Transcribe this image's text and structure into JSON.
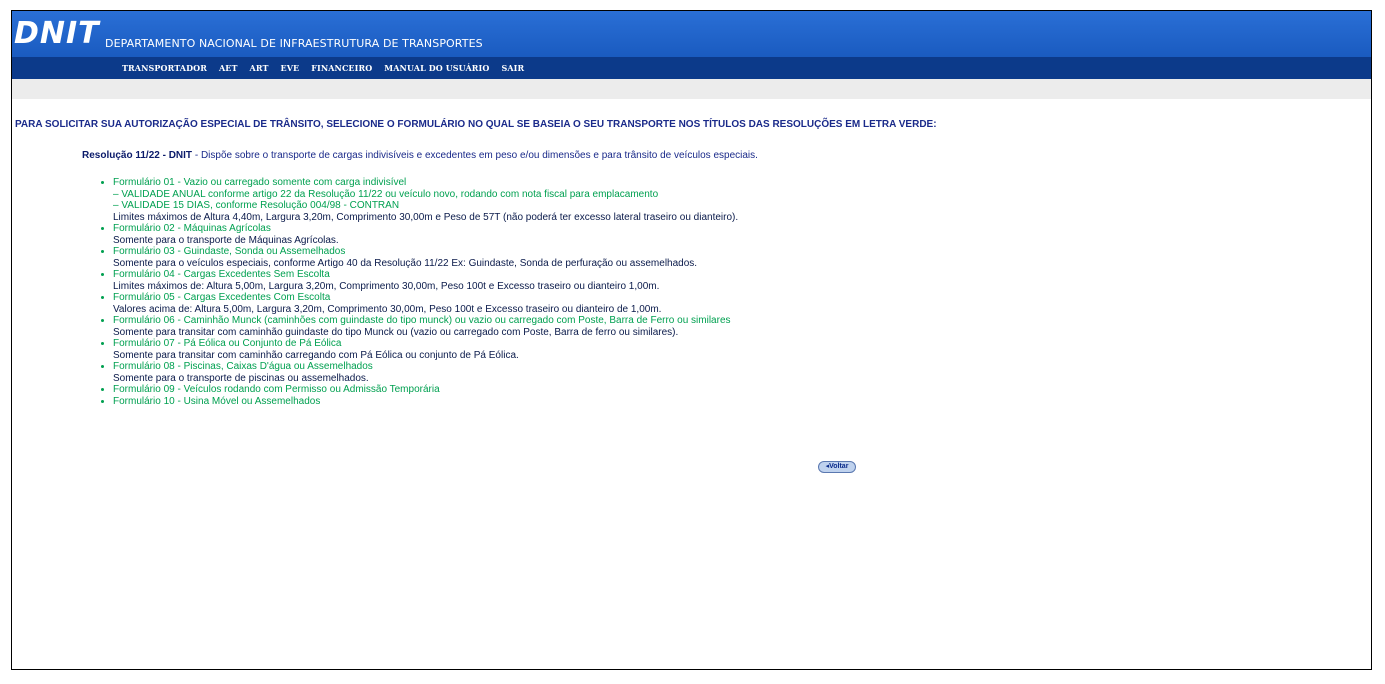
{
  "header": {
    "logo": "DNIT",
    "subtitle": "DEPARTAMENTO NACIONAL DE INFRAESTRUTURA DE TRANSPORTES"
  },
  "nav": [
    "TRANSPORTADOR",
    "AET",
    "ART",
    "EVE",
    "FINANCEIRO",
    "MANUAL DO USUÁRIO",
    "SAIR"
  ],
  "intro": "PARA SOLICITAR SUA AUTORIZAÇÃO ESPECIAL DE TRÂNSITO, SELECIONE O FORMULÁRIO NO QUAL SE BASEIA O SEU TRANSPORTE NOS TÍTULOS DAS RESOLUÇÕES EM LETRA VERDE:",
  "resolution": {
    "code": "Resolução 11/22 - DNIT",
    "separator": " - ",
    "description": "Dispõe sobre o transporte de cargas indivisíveis e excedentes em peso e/ou dimensões e para trânsito de veículos especiais."
  },
  "forms": [
    {
      "title": "Formulário 01 - Vazio ou carregado somente com carga indivisível",
      "green_notes": [
        "– VALIDADE ANUAL conforme artigo 22 da Resolução 11/22 ou veículo novo, rodando com nota fiscal para emplacamento",
        "– VALIDADE 15 DIAS, conforme Resolução 004/98 - CONTRAN"
      ],
      "desc": "Limites máximos de Altura 4,40m, Largura 3,20m, Comprimento 30,00m e Peso de 57T (não poderá ter excesso lateral traseiro ou dianteiro)."
    },
    {
      "title": "Formulário 02 - Máquinas Agrícolas",
      "desc": "Somente para o transporte de Máquinas Agrícolas."
    },
    {
      "title": "Formulário 03 - Guindaste, Sonda ou Assemelhados",
      "desc": "Somente para o veículos especiais, conforme Artigo 40 da Resolução 11/22 Ex: Guindaste, Sonda de perfuração ou assemelhados."
    },
    {
      "title": "Formulário 04 - Cargas Excedentes Sem Escolta",
      "desc": "Limites máximos de: Altura 5,00m, Largura 3,20m, Comprimento 30,00m, Peso 100t e Excesso traseiro ou dianteiro 1,00m."
    },
    {
      "title": "Formulário 05 - Cargas Excedentes Com Escolta",
      "desc": "Valores acima de: Altura 5,00m, Largura 3,20m, Comprimento 30,00m, Peso 100t e Excesso traseiro ou dianteiro de 1,00m."
    },
    {
      "title": "Formulário 06 - Caminhão Munck (caminhões com guindaste do tipo munck) ou vazio ou carregado com Poste, Barra de Ferro ou similares",
      "desc": "Somente para transitar com caminhão guindaste do tipo Munck ou (vazio ou carregado com Poste, Barra de ferro ou similares)."
    },
    {
      "title": "Formulário 07 - Pá Eólica ou Conjunto de Pá Eólica",
      "desc": "Somente para transitar com caminhão carregando com Pá Eólica ou conjunto de Pá Eólica."
    },
    {
      "title": "Formulário 08 - Piscinas, Caixas D'água ou Assemelhados",
      "desc": "Somente para o transporte de piscinas ou assemelhados."
    },
    {
      "title": "Formulário 09 - Veículos rodando com Permisso ou Admissão Temporária",
      "desc": ""
    },
    {
      "title": "Formulário 10 - Usina Móvel ou Assemelhados",
      "desc": ""
    }
  ],
  "voltar_label": "Voltar",
  "colors": {
    "header": "#1f63c9",
    "nav": "#0c3a8a",
    "link_green": "#00a050",
    "text_navy": "#1a2a8a"
  }
}
